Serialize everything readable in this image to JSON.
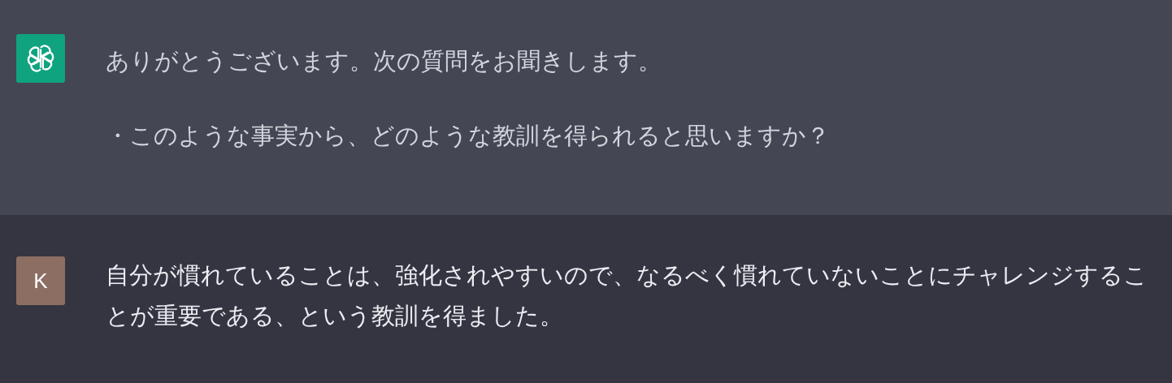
{
  "messages": [
    {
      "kind": "assistant",
      "color": "#10a37f",
      "paragraphs": [
        "ありがとうございます。次の質問をお聞きします。",
        "・このような事実から、どのような教訓を得られると思いますか？"
      ]
    },
    {
      "kind": "user",
      "color": "#8d6e63",
      "avatar_letter": "K",
      "paragraphs": [
        "自分が慣れていることは、強化されやすいので、なるべく慣れていないことにチャレンジすることが重要である、という教訓を得ました。"
      ]
    }
  ]
}
